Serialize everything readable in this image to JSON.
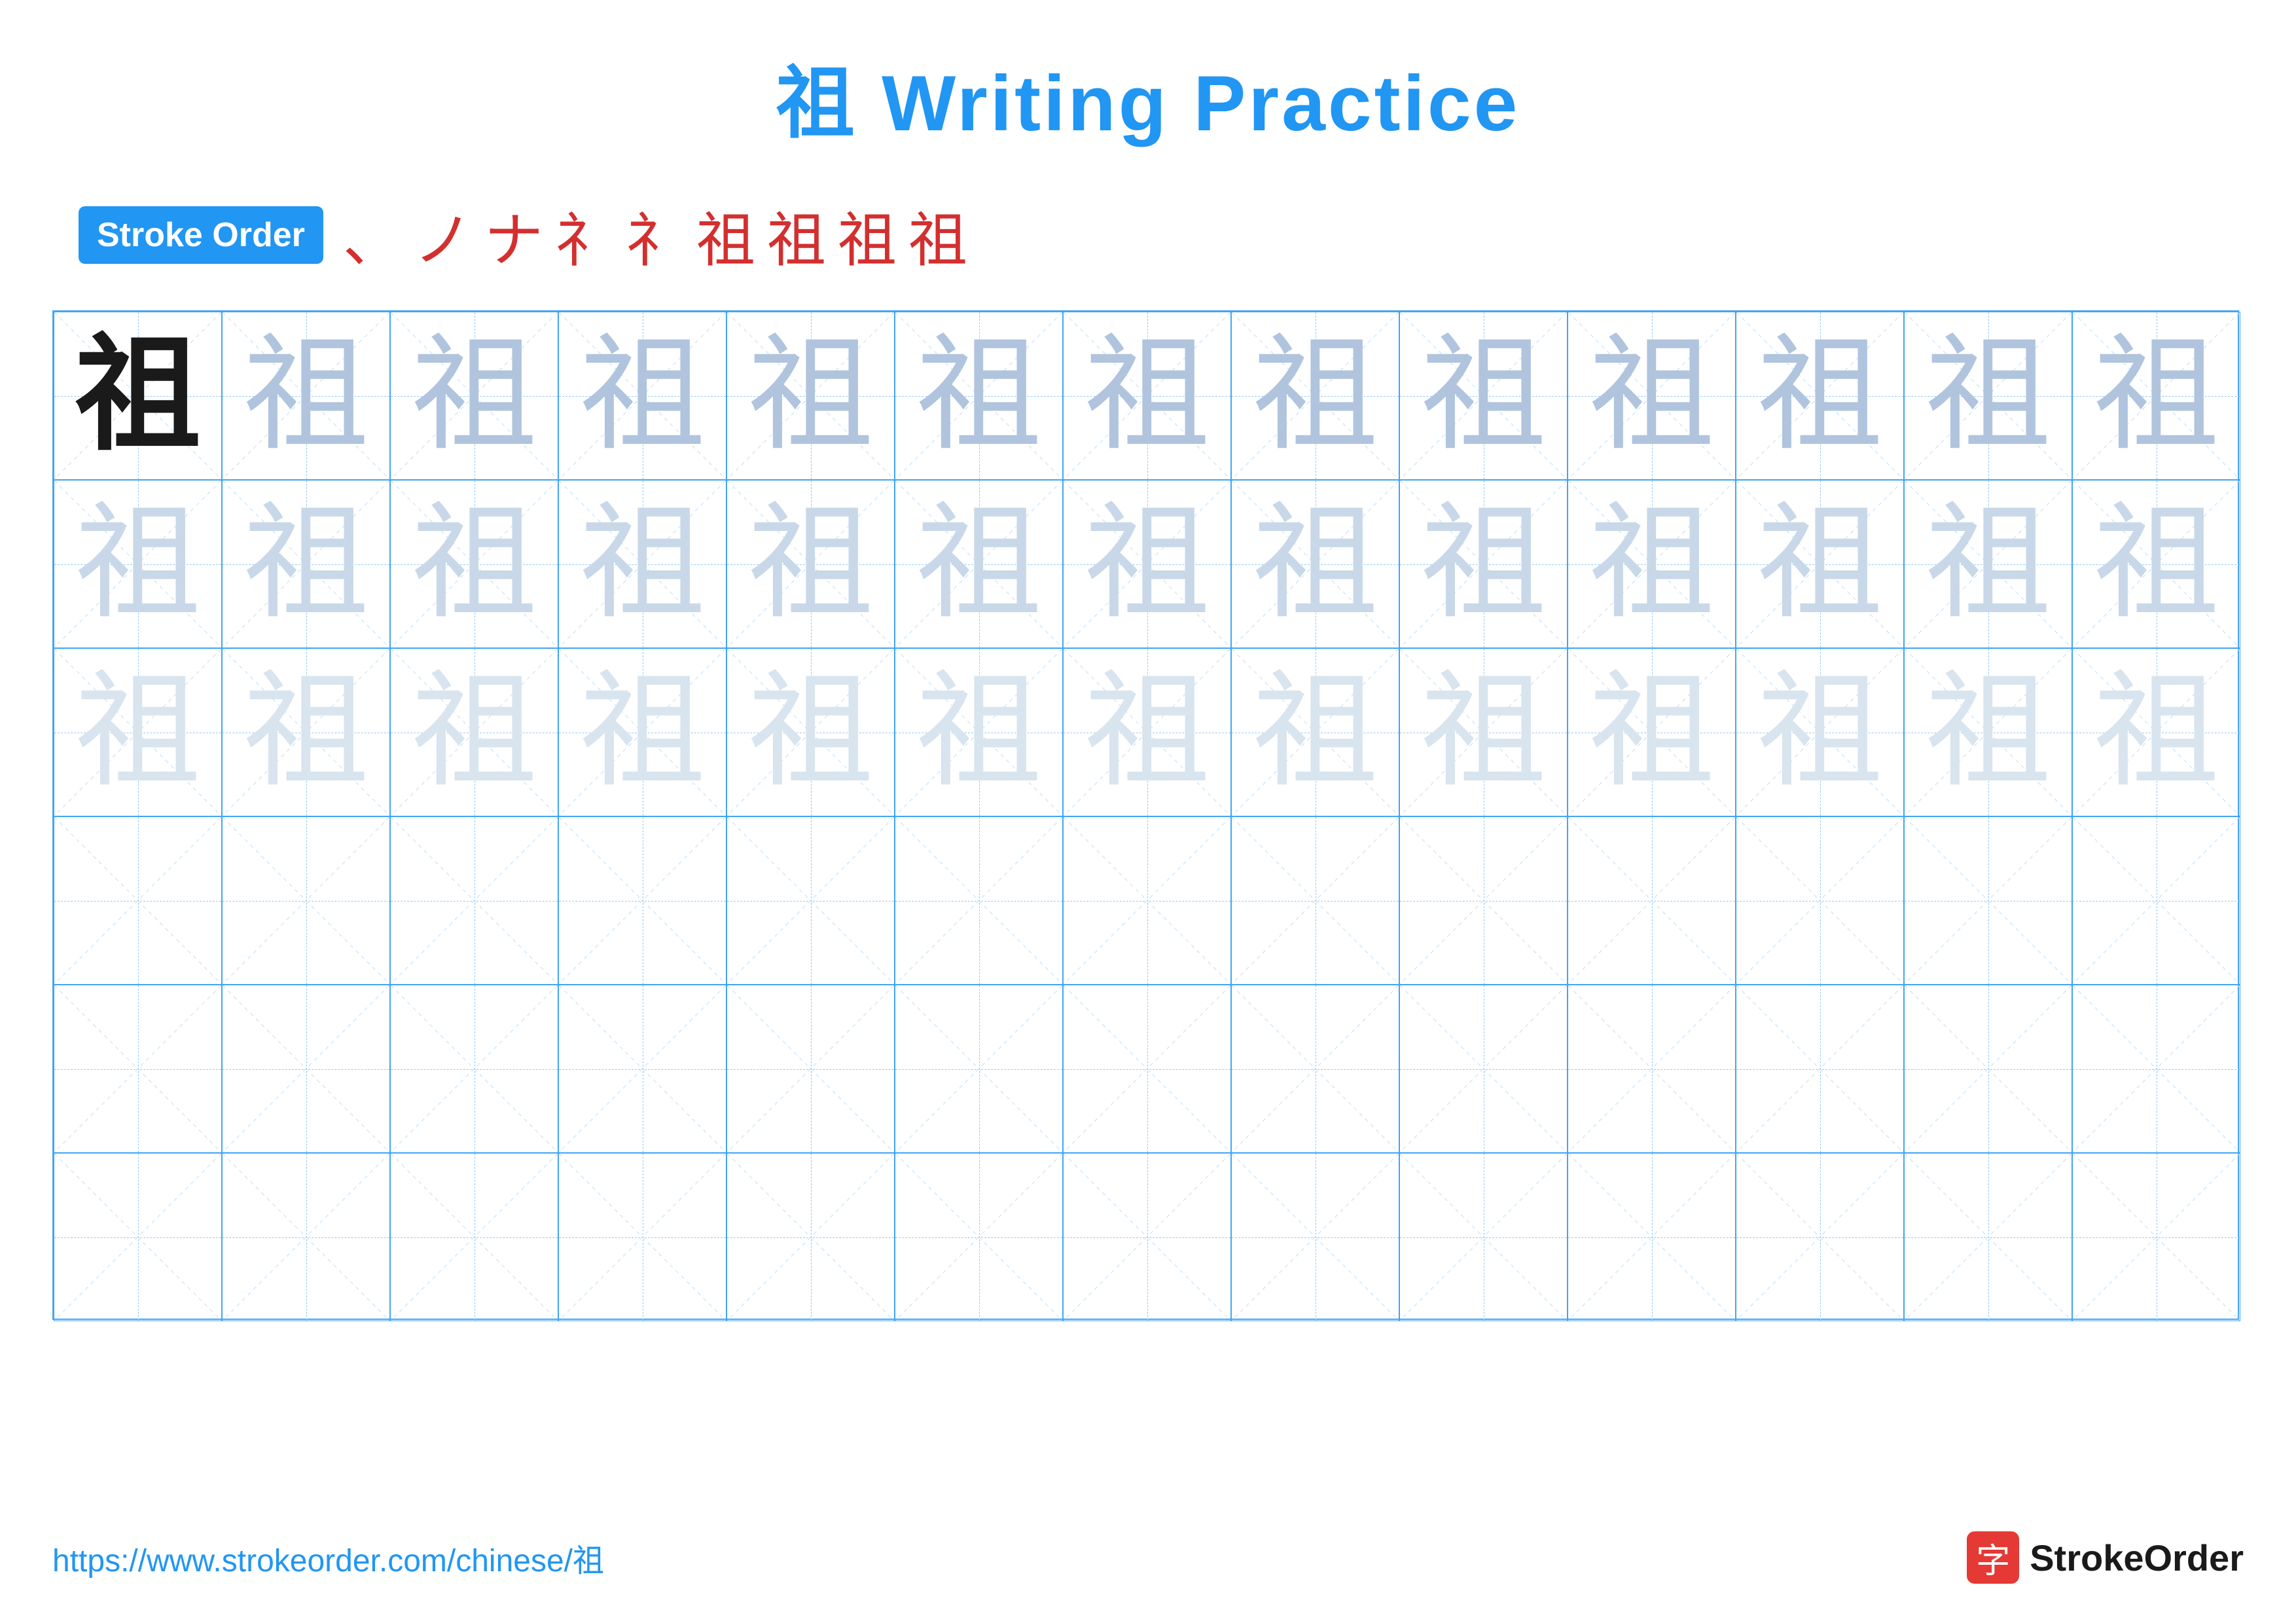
{
  "title": "祖 Writing Practice",
  "stroke_order_badge": "Stroke Order",
  "stroke_sequence": [
    "、",
    "ノ",
    "ナ",
    "礻",
    "礻",
    "祖",
    "祖",
    "祖",
    "祖"
  ],
  "grid": {
    "cols": 13,
    "rows": 6,
    "char": "祖",
    "row_styles": [
      "dark",
      "medium",
      "light",
      "empty",
      "empty",
      "empty"
    ]
  },
  "footer": {
    "url": "https://www.strokeorder.com/chinese/祖",
    "logo_char": "字",
    "logo_name": "StrokeOrder"
  }
}
